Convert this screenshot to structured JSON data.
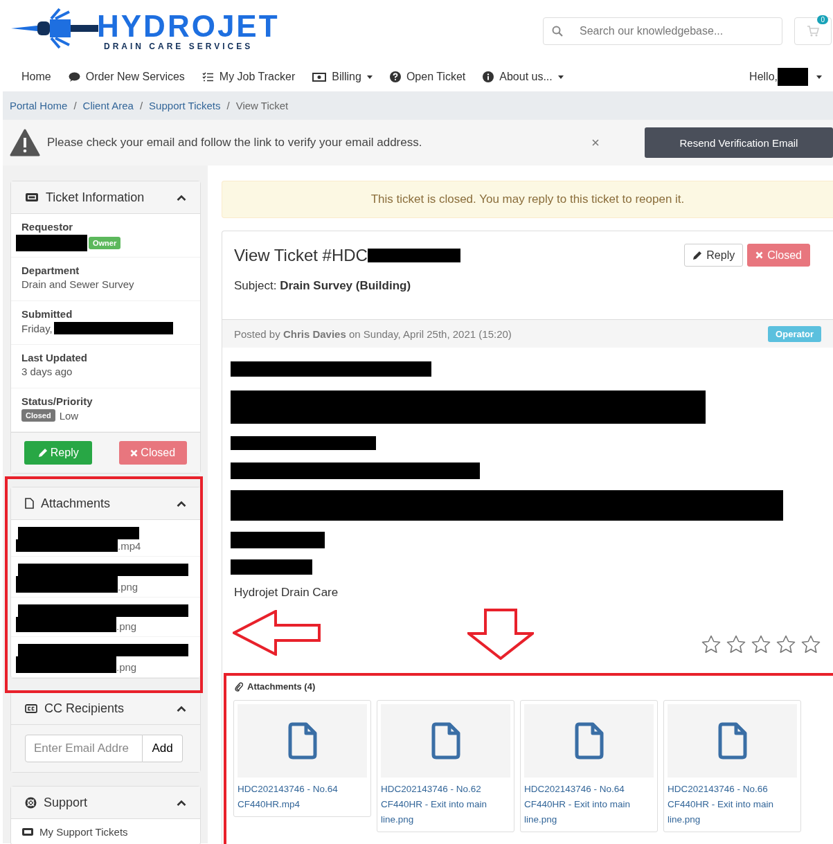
{
  "logo": {
    "name": "HYDROJET",
    "tagline": "DRAIN CARE SERVICES"
  },
  "search": {
    "placeholder": "Search our knowledgebase..."
  },
  "cart": {
    "count": "0"
  },
  "nav": [
    {
      "label": "Home",
      "dropdown": false
    },
    {
      "label": "Order New Services",
      "dropdown": false
    },
    {
      "label": "My Job Tracker",
      "dropdown": false
    },
    {
      "label": "Billing",
      "dropdown": true
    },
    {
      "label": "Open Ticket",
      "dropdown": false
    },
    {
      "label": "About us...",
      "dropdown": true
    }
  ],
  "greeting": "Hello,",
  "breadcrumb": [
    {
      "label": "Portal Home",
      "kind": "link"
    },
    {
      "label": "/",
      "kind": "separator"
    },
    {
      "label": "Client Area",
      "kind": "link"
    },
    {
      "label": "/",
      "kind": "separator"
    },
    {
      "label": "Support Tickets",
      "kind": "link"
    },
    {
      "label": "/",
      "kind": "separator"
    },
    {
      "label": "View Ticket",
      "kind": "current"
    }
  ],
  "alert": {
    "message": "Please check your email and follow the link to verify your email address.",
    "button": "Resend Verification Email"
  },
  "ticket_info": {
    "title": "Ticket Information",
    "fields": [
      {
        "label": "Requestor",
        "kind": "owner",
        "badge": "Owner"
      },
      {
        "label": "Department",
        "kind": "text",
        "value": "Drain and Sewer Survey"
      },
      {
        "label": "Submitted",
        "kind": "redacted",
        "value": "Friday,"
      },
      {
        "label": "Last Updated",
        "kind": "text",
        "value": "3 days ago"
      },
      {
        "label": "Status/Priority",
        "kind": "status",
        "badge": "Closed",
        "value": "Low"
      }
    ],
    "buttons": [
      {
        "label": "Reply",
        "kind": "reply"
      },
      {
        "label": "Closed",
        "kind": "closed"
      }
    ]
  },
  "side_attachments": {
    "title": "Attachments",
    "items": [
      {
        "suffix": ".mp4"
      },
      {
        "suffix": ".png"
      },
      {
        "suffix": ".png"
      },
      {
        "suffix": ".png"
      }
    ]
  },
  "cc": {
    "title": "CC Recipients",
    "placeholder": "Enter Email Addre",
    "button": "Add"
  },
  "support": {
    "title": "Support",
    "items": [
      "My Support Tickets"
    ]
  },
  "notice": "This ticket is closed. You may reply to this ticket to reopen it.",
  "ticket": {
    "title": "View Ticket #HDC",
    "subject": "Subject: **Drain Survey (Building)**",
    "buttons": [
      {
        "label": "Reply",
        "kind": "reply"
      },
      {
        "label": "Closed",
        "kind": "closed"
      }
    ],
    "byline": "Posted by **Chris Davies** on Sunday, April 25th, 2021 (15:20)",
    "role": "Operator",
    "signature": "Hydrojet Drain Care",
    "stars": 0,
    "attachments": {
      "title": "Attachments (4)",
      "files": [
        {
          "name": "HDC202143746 - No.64 CF440HR.mp4"
        },
        {
          "name": "HDC202143746 - No.62 CF440HR - Exit into main line.png"
        },
        {
          "name": "HDC202143746 - No.64 CF440HR - Exit into main line.png"
        },
        {
          "name": "HDC202143746 - No.66 CF440HR - Exit into main line.png"
        }
      ]
    }
  }
}
